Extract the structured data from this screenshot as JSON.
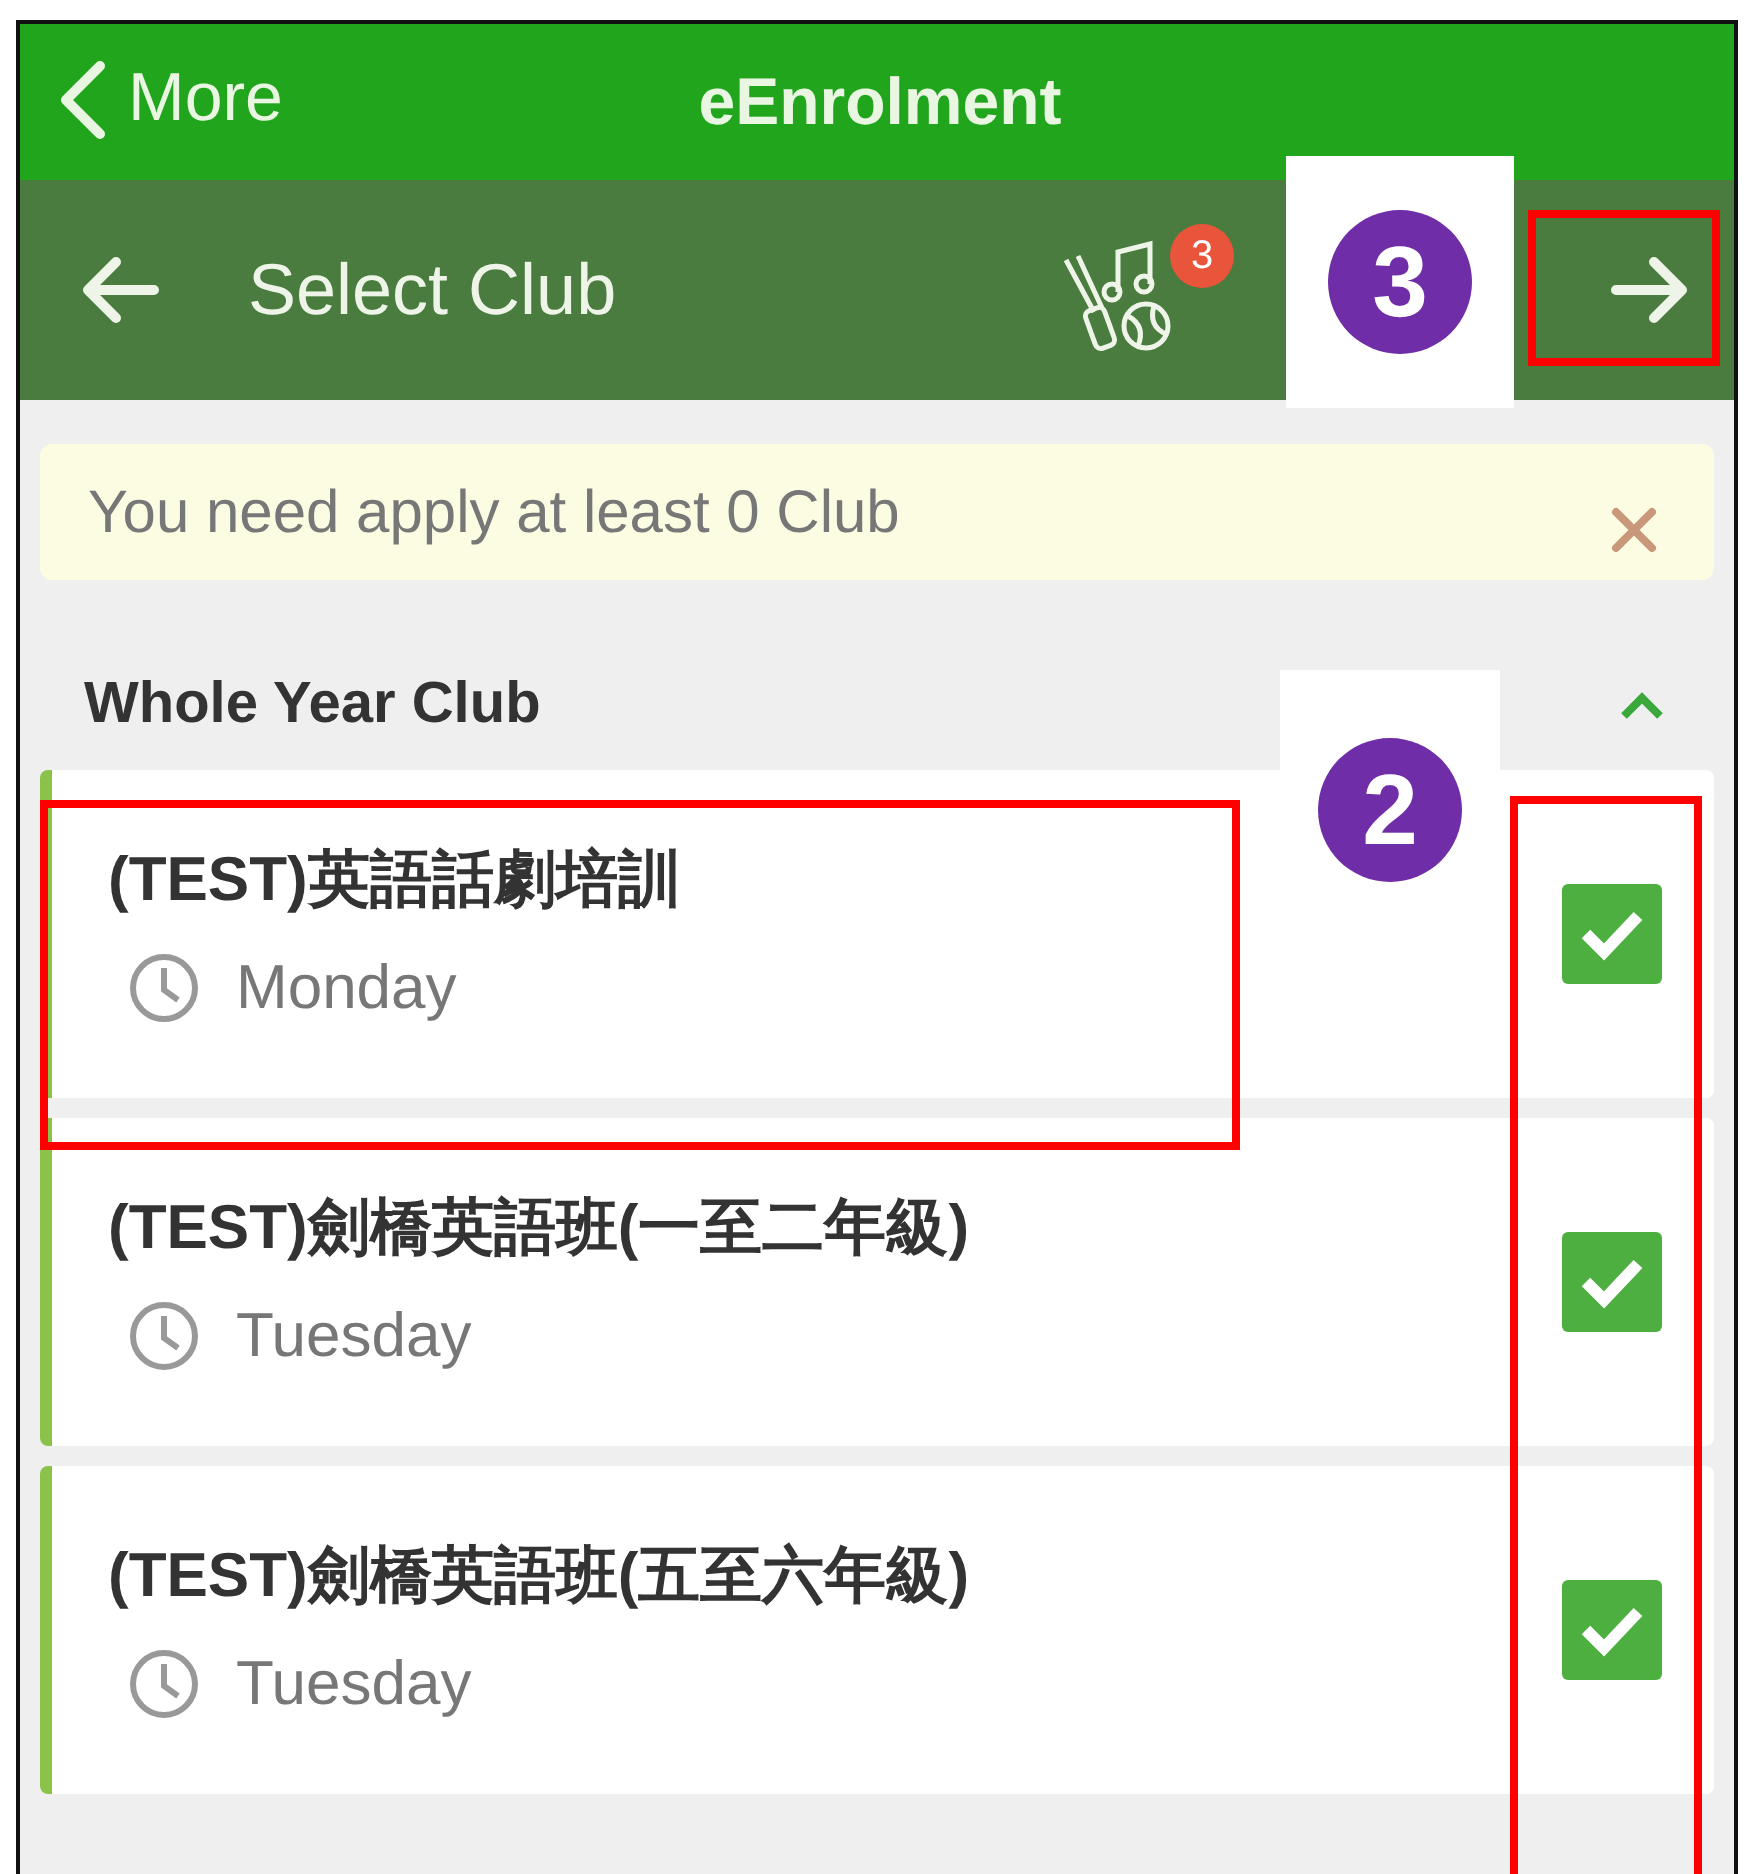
{
  "header": {
    "back_label": "More",
    "title": "eEnrolment"
  },
  "toolbar": {
    "title": "Select Club",
    "badge": "3"
  },
  "alert": {
    "text": "You need apply at least 0 Club"
  },
  "section": {
    "title": "Whole Year Club",
    "expanded": true
  },
  "clubs": [
    {
      "name": "(TEST)英語話劇培訓",
      "day": "Monday",
      "checked": true
    },
    {
      "name": "(TEST)劍橋英語班(一至二年級)",
      "day": "Tuesday",
      "checked": true
    },
    {
      "name": "(TEST)劍橋英語班(五至六年級)",
      "day": "Tuesday",
      "checked": true
    }
  ],
  "callouts": [
    {
      "label": "3",
      "kind": "next-button"
    },
    {
      "label": "2",
      "kind": "checkboxes"
    }
  ],
  "highlights": [
    {
      "kind": "next-button"
    },
    {
      "kind": "first-club"
    },
    {
      "kind": "checkbox-column"
    }
  ]
}
